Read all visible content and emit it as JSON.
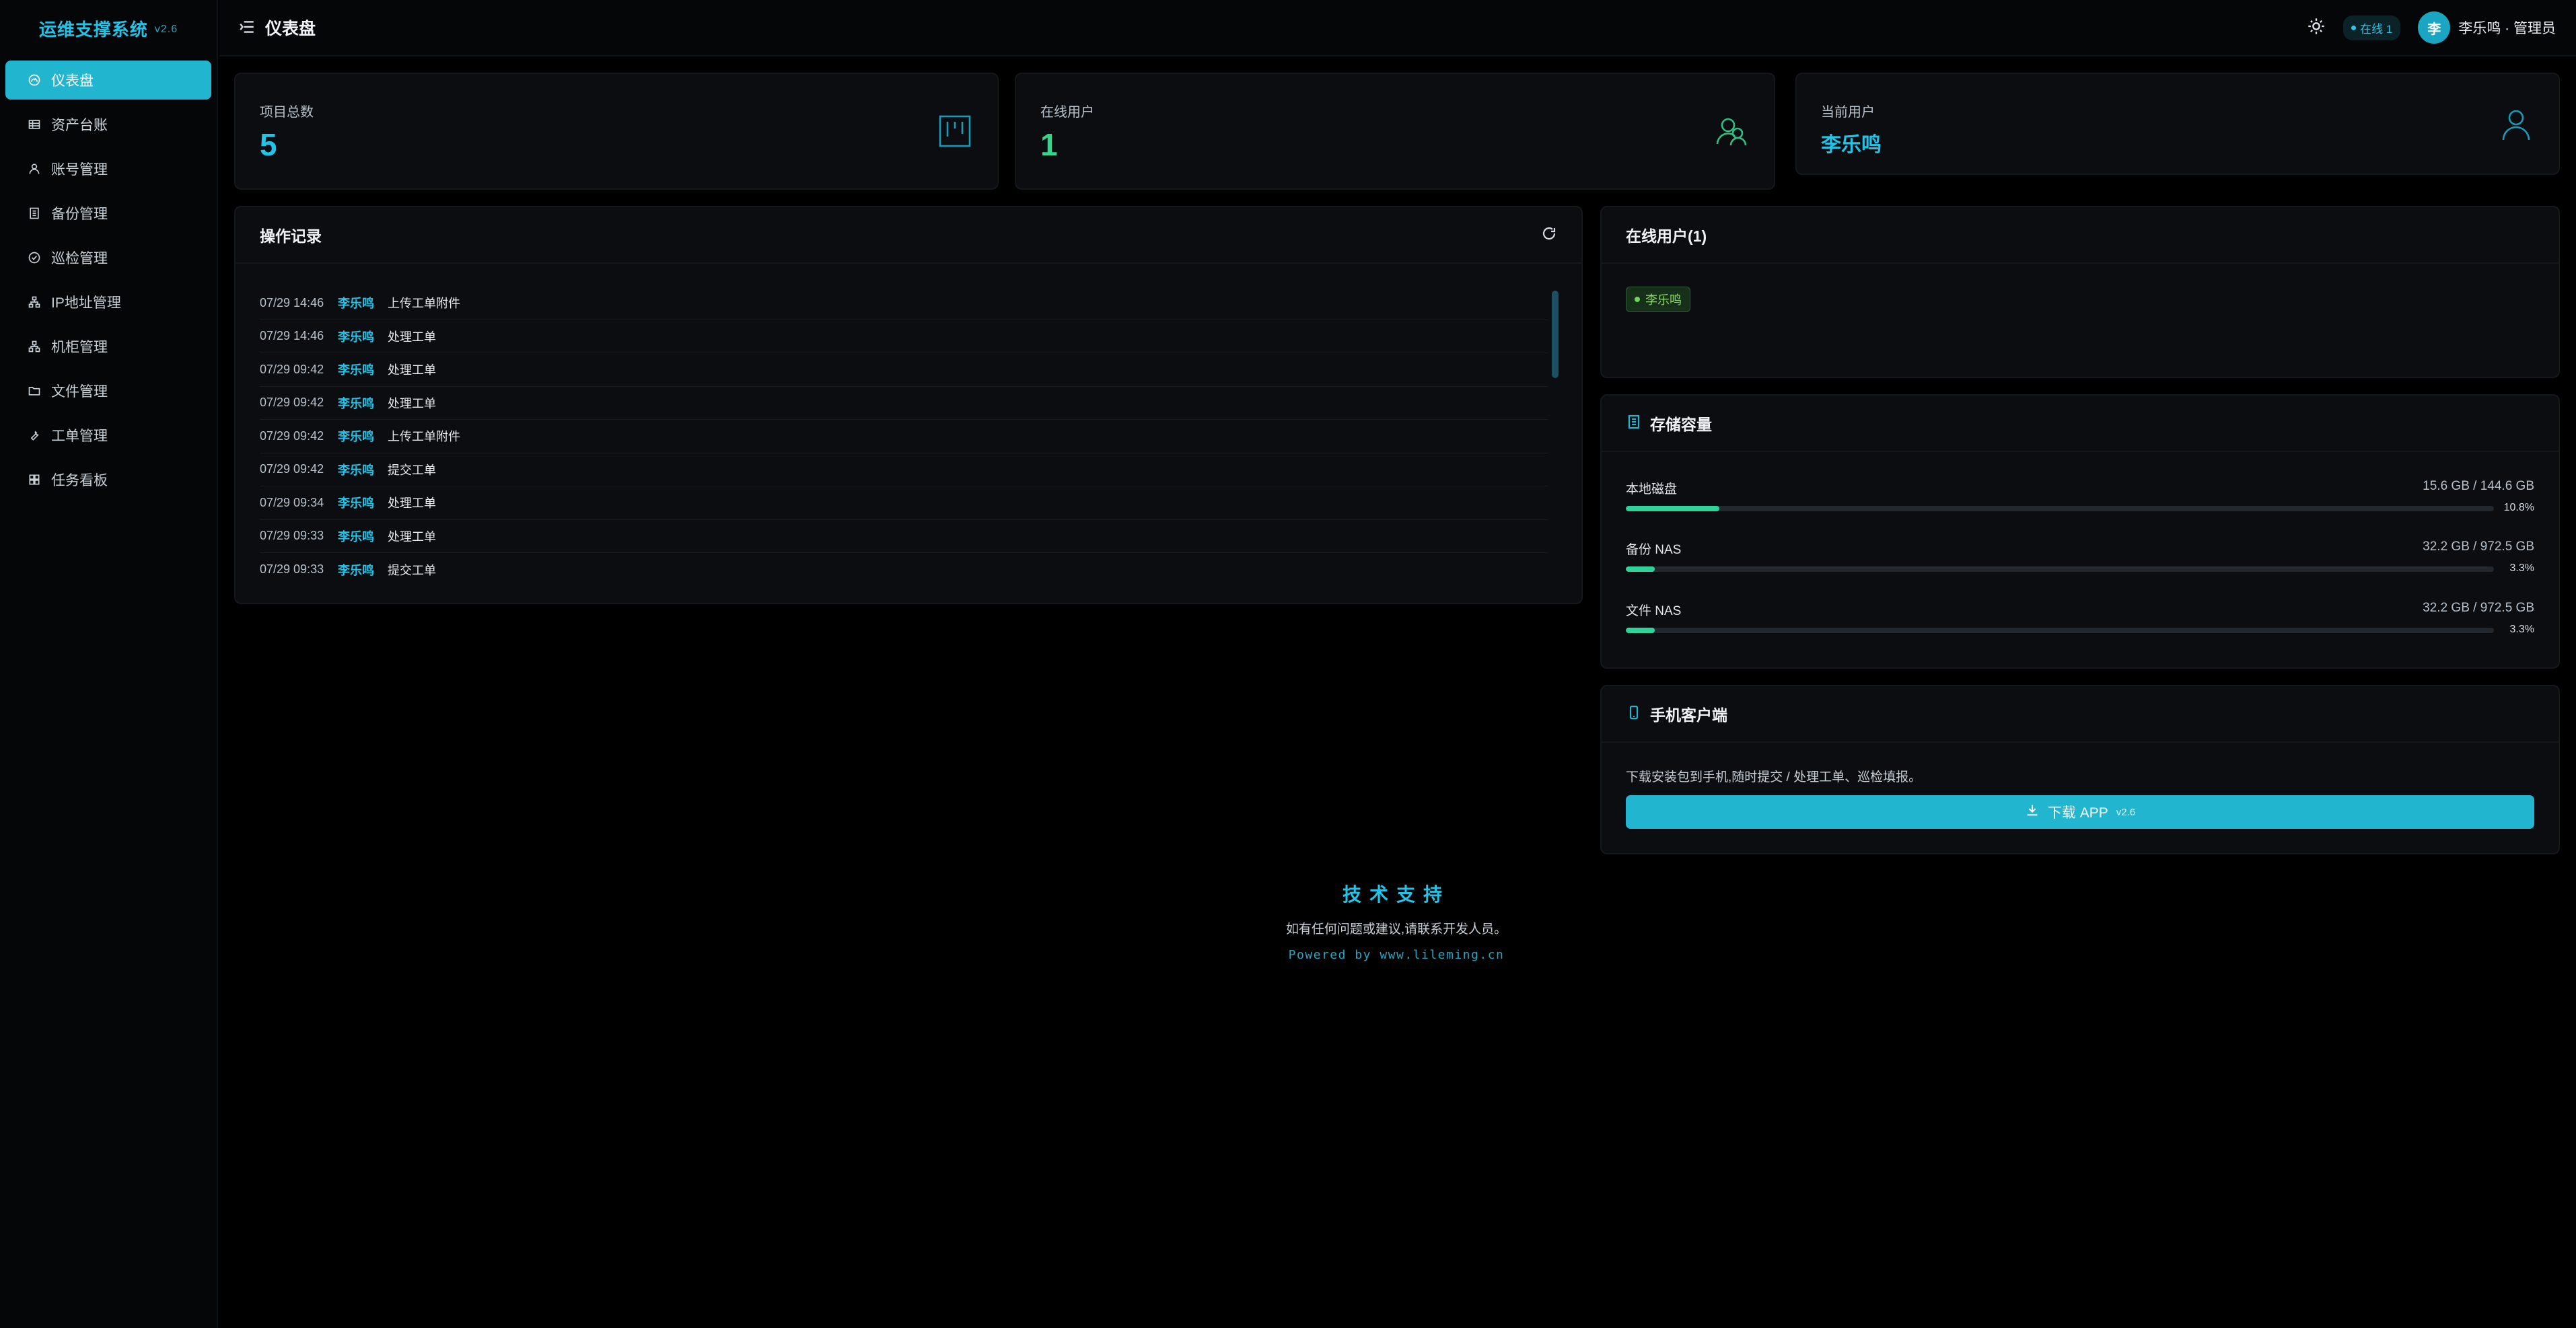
{
  "app": {
    "name": "运维支撑系统",
    "version": "v2.6"
  },
  "sidebar": {
    "items": [
      {
        "label": "仪表盘",
        "icon": "dashboard-icon",
        "active": true
      },
      {
        "label": "资产台账",
        "icon": "table-icon"
      },
      {
        "label": "账号管理",
        "icon": "user-icon"
      },
      {
        "label": "备份管理",
        "icon": "backup-icon"
      },
      {
        "label": "巡检管理",
        "icon": "check-circle-icon"
      },
      {
        "label": "IP地址管理",
        "icon": "network-icon"
      },
      {
        "label": "机柜管理",
        "icon": "cabinet-icon"
      },
      {
        "label": "文件管理",
        "icon": "folder-icon"
      },
      {
        "label": "工单管理",
        "icon": "wrench-icon"
      },
      {
        "label": "任务看板",
        "icon": "grid-icon"
      }
    ]
  },
  "header": {
    "title": "仪表盘",
    "online_badge": "在线 1",
    "avatar_text": "李",
    "user_label": "李乐鸣 · 管理员"
  },
  "stats": {
    "projects": {
      "label": "项目总数",
      "value": "5"
    },
    "online": {
      "label": "在线用户",
      "value": "1"
    },
    "current": {
      "label": "当前用户",
      "value": "李乐鸣"
    }
  },
  "log": {
    "title": "操作记录",
    "rows": [
      {
        "time": "07/29 14:46",
        "user": "李乐鸣",
        "action": "上传工单附件"
      },
      {
        "time": "07/29 14:46",
        "user": "李乐鸣",
        "action": "处理工单"
      },
      {
        "time": "07/29 09:42",
        "user": "李乐鸣",
        "action": "处理工单"
      },
      {
        "time": "07/29 09:42",
        "user": "李乐鸣",
        "action": "处理工单"
      },
      {
        "time": "07/29 09:42",
        "user": "李乐鸣",
        "action": "上传工单附件"
      },
      {
        "time": "07/29 09:42",
        "user": "李乐鸣",
        "action": "提交工单"
      },
      {
        "time": "07/29 09:34",
        "user": "李乐鸣",
        "action": "处理工单"
      },
      {
        "time": "07/29 09:33",
        "user": "李乐鸣",
        "action": "处理工单"
      },
      {
        "time": "07/29 09:33",
        "user": "李乐鸣",
        "action": "提交工单"
      }
    ]
  },
  "online_users": {
    "title": "在线用户(1)",
    "users": [
      "李乐鸣"
    ]
  },
  "storage": {
    "title": "存储容量",
    "items": [
      {
        "name": "本地磁盘",
        "size": "15.6 GB / 144.6 GB",
        "percent_label": "10.8%",
        "percent": 10.8
      },
      {
        "name": "备份 NAS",
        "size": "32.2 GB / 972.5 GB",
        "percent_label": "3.3%",
        "percent": 3.3
      },
      {
        "name": "文件 NAS",
        "size": "32.2 GB / 972.5 GB",
        "percent_label": "3.3%",
        "percent": 3.3
      }
    ]
  },
  "mobile": {
    "title": "手机客户端",
    "desc": "下载安装包到手机,随时提交 / 处理工单、巡检填报。",
    "button_label": "下载 APP",
    "button_version": "v2.6"
  },
  "footer": {
    "title": "技术支持",
    "subtitle": "如有任何问题或建议,请联系开发人员。",
    "powered": "Powered by www.lileming.cn"
  },
  "colors": {
    "accent": "#22b5cf",
    "accent_text": "#22c3e6",
    "success": "#34d58c",
    "bar": "#2fd39a",
    "background": "#000000",
    "card": "#0b0d10"
  }
}
